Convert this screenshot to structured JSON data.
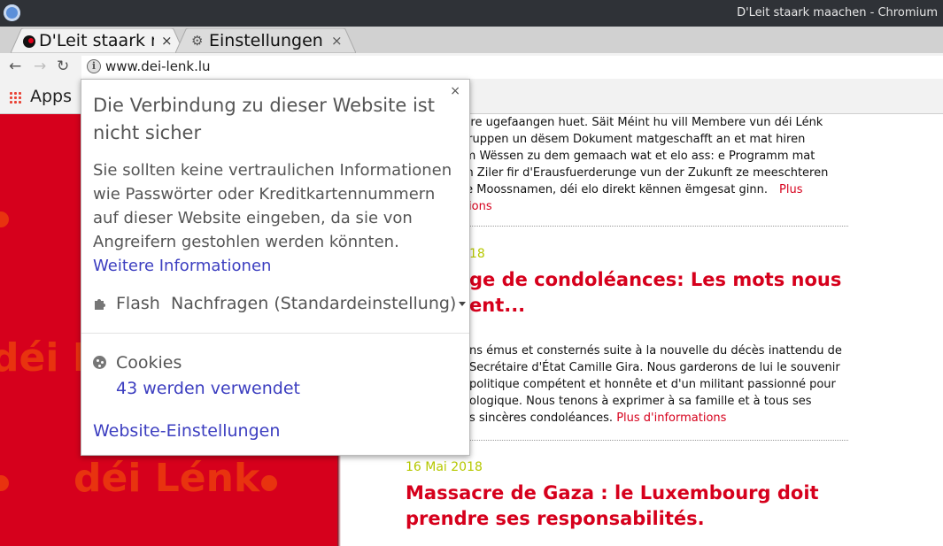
{
  "window": {
    "title": "D'Leit staark maachen - Chromium"
  },
  "tabs": [
    {
      "label": "D'Leit staark maachen",
      "close": "×"
    },
    {
      "label": "Einstellungen",
      "close": "×"
    }
  ],
  "toolbar": {
    "back": "←",
    "forward": "→",
    "reload": "↻",
    "url": "www.dei-lenk.lu"
  },
  "bookmarks": {
    "apps_label": "Apps"
  },
  "sidebar": {
    "watermark1": "déi Lé",
    "watermark2": "déi Lénk"
  },
  "articles": [
    {
      "text": "inaire ugefaangen huet. Säit Méint hu vill Membere vun déi Lénk\ntsgruppen un dësem Dokument matgeschafft an et mat hiren\nirem Wëssen zu dem gemaach wat et elo ass: e Programm mat\nrten Ziler fir d'Erausfuerderunge vun der Zukunft ze meeschteren\nrete Moossnamen, déi elo direkt kënnen ëmgesat ginn.",
      "more_part1": "Plus",
      "more_part2": "ations"
    },
    {
      "date": "18",
      "headline_line1": "ge de condoléances: Les mots nous",
      "headline_line2": "ent...",
      "text_lines": [
        "ns émus et consternés suite à la nouvelle du décès inattendu de",
        "Secrétaire d'État Camille Gira. Nous garderons de lui le souvenir",
        "politique compétent et honnête et d'un militant passionné pour",
        "ologique. Nous tenons à exprimer à sa famille et à tous ses",
        "s sincères condoléances."
      ],
      "more": "Plus d'informations"
    },
    {
      "date": "16 Mai 2018",
      "headline_line1": "Massacre de Gaza : le Luxembourg doit",
      "headline_line2": "prendre ses responsabilités."
    }
  ],
  "popup": {
    "close": "×",
    "title": "Die Verbindung zu dieser Website ist nicht sicher",
    "description": "Sie sollten keine vertraulichen Informationen wie Passwörter oder Kreditkartennummern auf dieser Website eingeben, da sie von Angreifern gestohlen werden könnten.",
    "more_info_link": "Weitere Informationen",
    "flash_label": "Flash",
    "flash_value": "Nachfragen (Standardeinstellung)",
    "cookies_label": "Cookies",
    "cookies_count": "43 werden verwendet",
    "site_settings_link": "Website-Einstellungen"
  },
  "colors": {
    "accent_red": "#d6001c",
    "date_green": "#b6c800",
    "link_blue": "#3c3ec0"
  }
}
